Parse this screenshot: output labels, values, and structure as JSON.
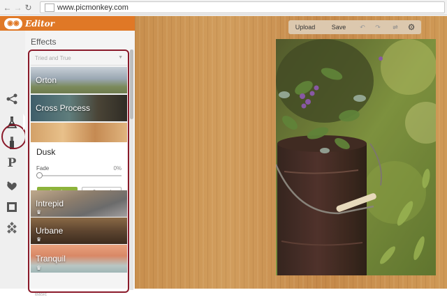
{
  "browser": {
    "back_icon": "back-arrow-icon",
    "forward_icon": "forward-arrow-icon",
    "reload_icon": "reload-icon",
    "url": "www.picmonkey.com"
  },
  "app": {
    "brand_color": "#e07826",
    "title": "Editor"
  },
  "tools": [
    {
      "name": "basic-edits-icon"
    },
    {
      "name": "effects-icon",
      "selected": true
    },
    {
      "name": "touch-up-icon"
    },
    {
      "name": "text-icon",
      "glyph": "P"
    },
    {
      "name": "overlays-icon"
    },
    {
      "name": "frames-icon"
    },
    {
      "name": "textures-icon"
    }
  ],
  "panel": {
    "title": "Effects",
    "group_label": "Tried and True",
    "effects": [
      {
        "label": "Orton"
      },
      {
        "label": "Cross Process"
      }
    ],
    "dusk": {
      "label": "Dusk",
      "fade_label": "Fade",
      "fade_value": "0%",
      "apply_label": "Apply",
      "cancel_label": "Cancel"
    },
    "premium_effects": [
      {
        "label": "Intrepid"
      },
      {
        "label": "Urbane"
      },
      {
        "label": "Tranquil"
      }
    ],
    "next_group_label": "Basic"
  },
  "toolbar": {
    "upload_label": "Upload",
    "save_label": "Save",
    "undo_icon": "undo-icon",
    "redo_icon": "redo-icon",
    "compare_icon": "compare-icon",
    "settings_icon": "gear-icon"
  }
}
